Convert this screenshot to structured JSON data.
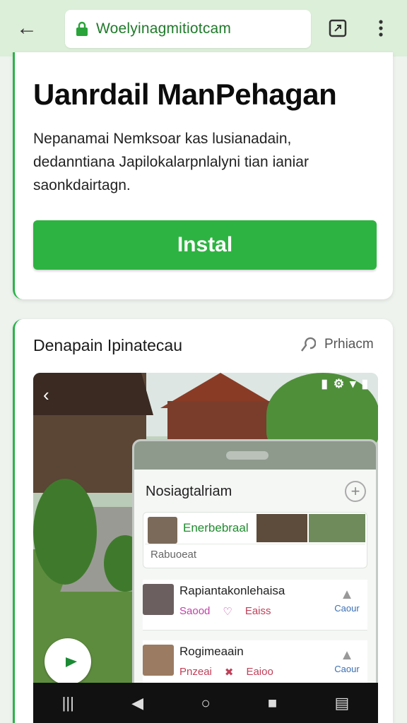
{
  "browser": {
    "url": "Woelyinagmitiotcam"
  },
  "app": {
    "title": "Uanrdail ManPehagan",
    "description": "Nepanamai Nemksoar kas lusianadain, dedanntiana Japilokalarpnlalyni tian ianiar saonkdairtagn.",
    "install_label": "Instal"
  },
  "screenshots": {
    "section_title": "Denapain Ipinatecau",
    "preview_label": "Prhiacm",
    "phone": {
      "header": "Nosiagtalriam",
      "featured_label": "Enerbebraal",
      "featured_sub": "Rabuoeat",
      "items": [
        {
          "title": "Rapiantakonlehaisa",
          "save": "Saood",
          "c": "Eaiss",
          "right": "Caour"
        },
        {
          "title": "Rogimeaain",
          "save": "Pnzeai",
          "c": "Eaioo",
          "right": "Caour"
        }
      ]
    }
  }
}
